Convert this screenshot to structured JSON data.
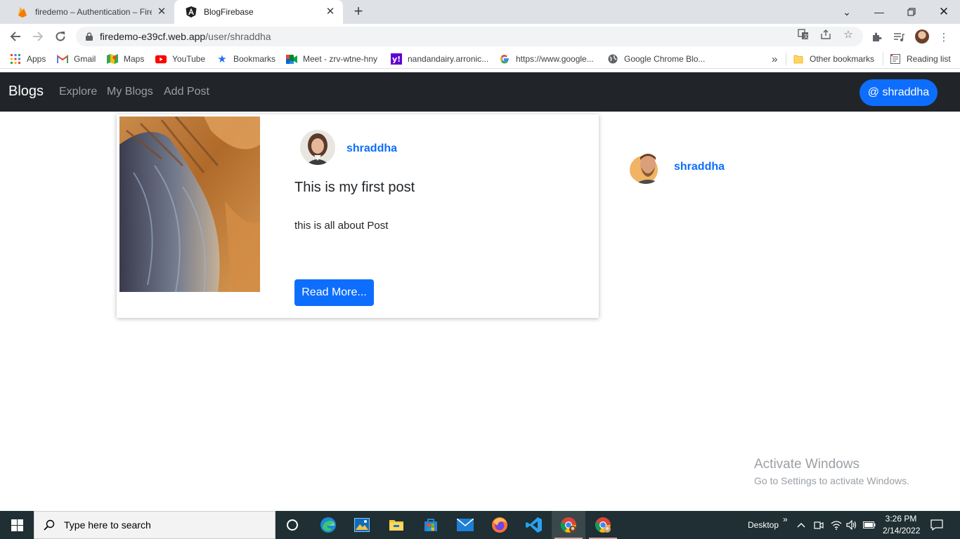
{
  "browser": {
    "tabs": [
      {
        "title": "firedemo – Authentication – Fireb",
        "active": false
      },
      {
        "title": "BlogFirebase",
        "active": true
      }
    ],
    "url_host": "firedemo-e39cf.web.app",
    "url_path": "/user/shraddha",
    "bookmarks": [
      {
        "label": "Apps",
        "icon": "apps-grid-icon"
      },
      {
        "label": "Gmail",
        "icon": "gmail-icon"
      },
      {
        "label": "Maps",
        "icon": "maps-icon"
      },
      {
        "label": "YouTube",
        "icon": "youtube-icon"
      },
      {
        "label": "Bookmarks",
        "icon": "star-icon"
      },
      {
        "label": "Meet - zrv-wtne-hny",
        "icon": "meet-icon"
      },
      {
        "label": "nandandairy.arronic...",
        "icon": "yahoo-icon"
      },
      {
        "label": "https://www.google...",
        "icon": "google-icon"
      },
      {
        "label": "Google Chrome Blo...",
        "icon": "globe-icon"
      }
    ],
    "bookmarks_overflow": "»",
    "other_bookmarks": "Other bookmarks",
    "reading_list": "Reading list"
  },
  "app": {
    "brand": "Blogs",
    "nav": [
      "Explore",
      "My Blogs",
      "Add Post"
    ],
    "user_button": "@ shraddha"
  },
  "post": {
    "author": "shraddha",
    "title": "This is my first post",
    "excerpt": "this is all about Post",
    "read_more": "Read More..."
  },
  "sidebar": {
    "author": "shraddha"
  },
  "watermark": {
    "line1": "Activate Windows",
    "line2": "Go to Settings to activate Windows."
  },
  "taskbar": {
    "search_placeholder": "Type here to search",
    "desktop_label": "Desktop",
    "time": "3:26 PM",
    "date": "2/14/2022"
  },
  "colors": {
    "primary": "#0d6efd",
    "navbar": "#212529",
    "taskbar": "#1f2f33"
  }
}
